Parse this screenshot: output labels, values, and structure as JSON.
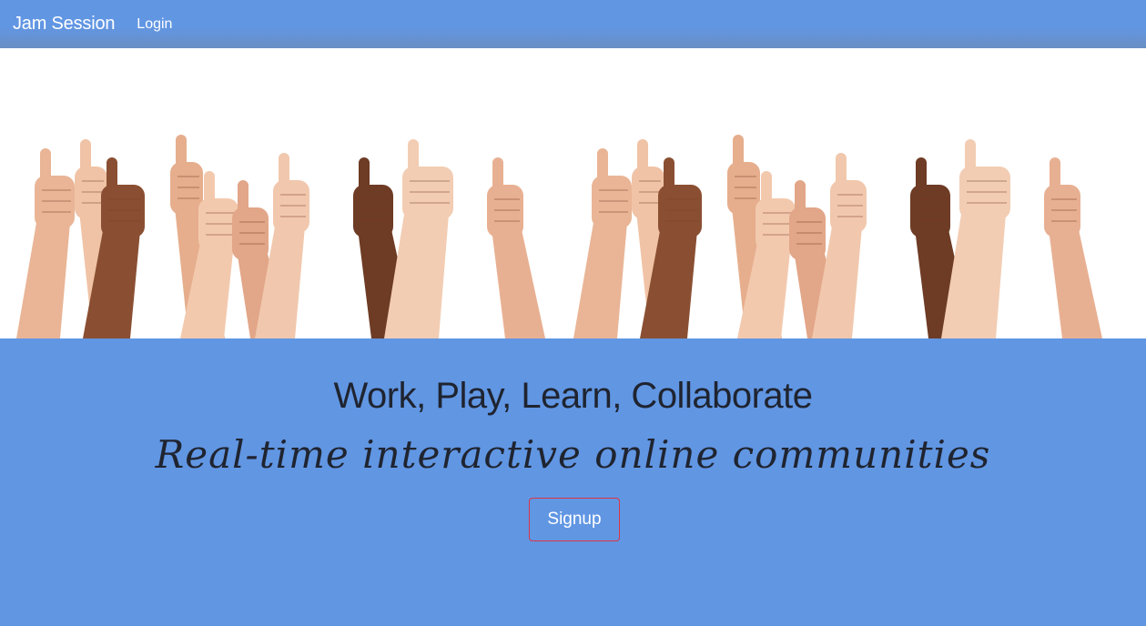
{
  "navbar": {
    "brand": "Jam Session",
    "links": [
      {
        "label": "Login"
      }
    ]
  },
  "hero": {
    "image_description_icon": "thumbs-up-hands-banner"
  },
  "main": {
    "headline": "Work, Play, Learn, Collaborate",
    "tagline": "Real-time interactive online communities",
    "signup_label": "Signup"
  },
  "colors": {
    "background": "#6196e3",
    "text_dark": "#1f2430",
    "button_border": "#dc3545",
    "nav_text": "#ffffff"
  }
}
